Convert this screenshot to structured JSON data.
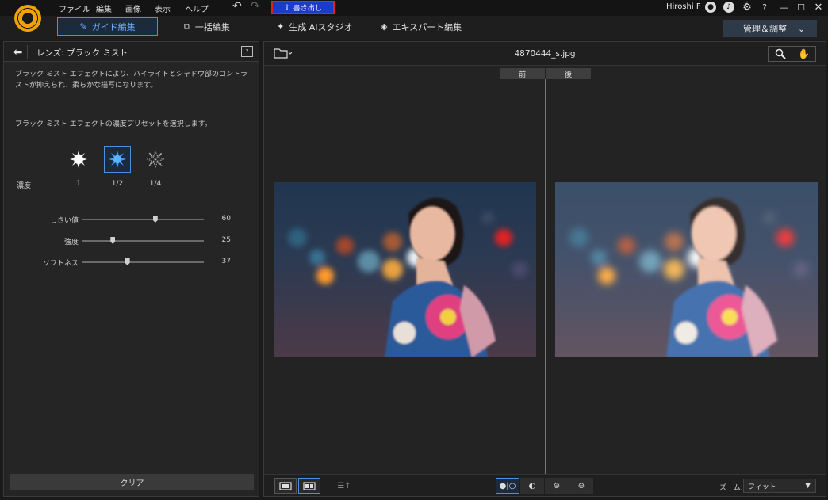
{
  "menu": {
    "items": [
      {
        "label": "ファイル"
      },
      {
        "label": "編集"
      },
      {
        "label": "画像"
      },
      {
        "label": "表示"
      },
      {
        "label": "ヘルプ"
      }
    ],
    "export_label": "書き出し"
  },
  "user": {
    "name": "Hiroshi F"
  },
  "modes": {
    "tabs": [
      {
        "label": "ガイド編集",
        "icon": "wand-icon",
        "active": true
      },
      {
        "label": "一括編集",
        "icon": "batch-icon",
        "active": false
      },
      {
        "label": "生成 AIスタジオ",
        "icon": "sparkle-icon",
        "active": false
      },
      {
        "label": "エキスパート編集",
        "icon": "layers-icon",
        "active": false
      }
    ],
    "manage_label": "管理＆調整"
  },
  "panel": {
    "title": "レンズ: ブラック ミスト",
    "description": "ブラック ミスト エフェクトにより、ハイライトとシャドウ部のコントラストが抑えられ、柔らかな描写になります。",
    "preset_prompt": "ブラック ミスト エフェクトの濃度プリセットを選択します。",
    "density_label": "濃度",
    "presets": [
      {
        "label": "1",
        "selected": false
      },
      {
        "label": "1/2",
        "selected": true
      },
      {
        "label": "1/4",
        "selected": false
      }
    ],
    "sliders": [
      {
        "label": "しきい値",
        "value": "60",
        "fraction": 0.6
      },
      {
        "label": "強度",
        "value": "25",
        "fraction": 0.25
      },
      {
        "label": "ソフトネス",
        "value": "37",
        "fraction": 0.37
      }
    ],
    "clear_label": "クリア"
  },
  "viewer": {
    "filename": "4870444_s.jpg",
    "before_label": "前",
    "after_label": "後"
  },
  "zoom": {
    "label": "ズーム:",
    "value": "フィット"
  },
  "colors": {
    "accent": "#4a90e2",
    "export_bg": "#1a3cc8",
    "export_border": "#e02020",
    "logo": "#f0a300"
  }
}
